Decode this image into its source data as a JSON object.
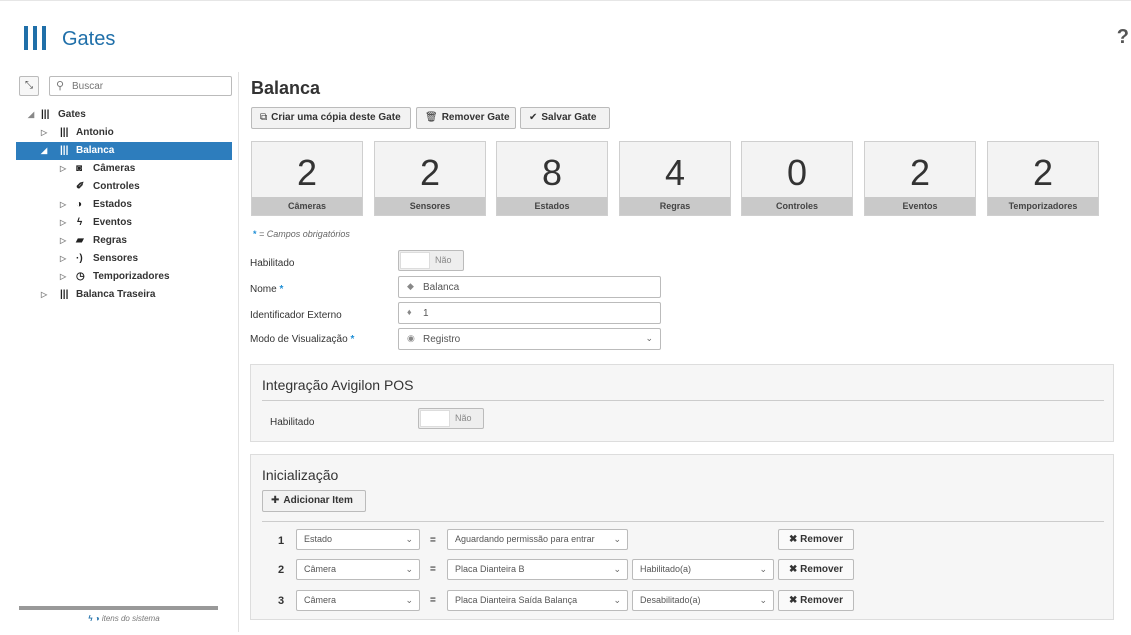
{
  "app": {
    "title": "Gates",
    "help": "?"
  },
  "sidebar": {
    "collapse_icon": "collapse-icon",
    "search_placeholder": "Buscar",
    "tree": [
      {
        "label": "Gates",
        "level": 0,
        "icon": "gates-icon"
      },
      {
        "label": "Antonio",
        "level": 1,
        "icon": "gate-icon"
      },
      {
        "label": "Balanca",
        "level": 1,
        "icon": "gate-icon",
        "selected": true
      },
      {
        "label": "Câmeras",
        "level": 2,
        "icon": "camera-icon"
      },
      {
        "label": "Controles",
        "level": 2,
        "icon": "wrench-icon"
      },
      {
        "label": "Estados",
        "level": 2,
        "icon": "half-circle-icon"
      },
      {
        "label": "Eventos",
        "level": 2,
        "icon": "lightning-icon"
      },
      {
        "label": "Regras",
        "level": 2,
        "icon": "book-icon"
      },
      {
        "label": "Sensores",
        "level": 2,
        "icon": "signal-icon"
      },
      {
        "label": "Temporizadores",
        "level": 2,
        "icon": "timer-icon"
      },
      {
        "label": "Balanca Traseira",
        "level": 1,
        "icon": "gate-icon"
      }
    ],
    "footer": "itens do sistema"
  },
  "main": {
    "title": "Balanca",
    "buttons": {
      "copy": "Criar uma cópia deste Gate",
      "remove": "Remover Gate",
      "save": "Salvar Gate"
    },
    "stats": [
      {
        "value": "2",
        "label": "Câmeras"
      },
      {
        "value": "2",
        "label": "Sensores"
      },
      {
        "value": "8",
        "label": "Estados"
      },
      {
        "value": "4",
        "label": "Regras"
      },
      {
        "value": "0",
        "label": "Controles"
      },
      {
        "value": "2",
        "label": "Eventos"
      },
      {
        "value": "2",
        "label": "Temporizadores"
      }
    ],
    "required_note": "= Campos obrigatórios",
    "form": {
      "enabled_label": "Habilitado",
      "enabled_value": "Não",
      "name_label": "Nome",
      "name_value": "Balanca",
      "external_id_label": "Identificador Externo",
      "external_id_value": "1",
      "view_mode_label": "Modo de Visualização",
      "view_mode_value": "Registro"
    },
    "avigilon": {
      "title": "Integração Avigilon POS",
      "enabled_label": "Habilitado",
      "enabled_value": "Não"
    },
    "init": {
      "title": "Inicialização",
      "add_label": "Adicionar Item",
      "eq": "=",
      "remove_label": "Remover",
      "rows": [
        {
          "num": "1",
          "type": "Estado",
          "value": "Aguardando permissão para entrar",
          "state": ""
        },
        {
          "num": "2",
          "type": "Câmera",
          "value": "Placa Dianteira B",
          "state": "Habilitado(a)"
        },
        {
          "num": "3",
          "type": "Câmera",
          "value": "Placa Dianteira Saída Balança",
          "state": "Desabilitado(a)"
        }
      ]
    }
  }
}
